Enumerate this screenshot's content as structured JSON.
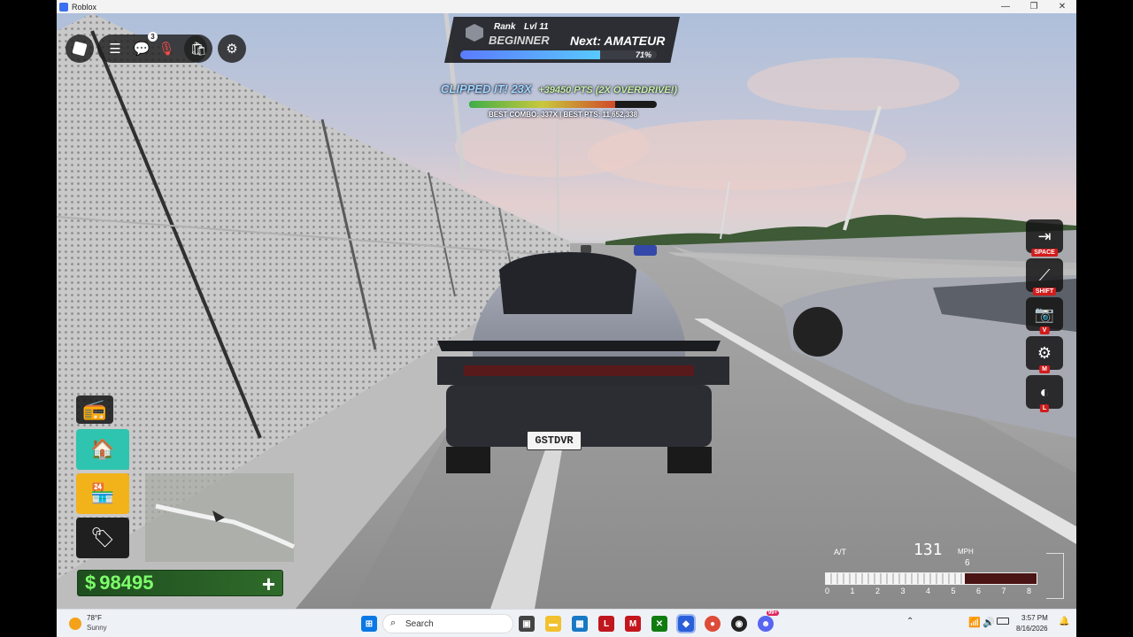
{
  "window": {
    "title": "Roblox",
    "controls": {
      "minimize": "—",
      "maximize": "❐",
      "close": "✕"
    }
  },
  "topbar": {
    "notification_count": "3",
    "icons": [
      "roblox-logo-icon",
      "menu-icon",
      "chat-icon",
      "mic-icon",
      "backpack-icon",
      "settings-icon"
    ]
  },
  "rank": {
    "label": "Rank",
    "level": "Lvl 11",
    "current": "BEGINNER",
    "next": "Next: AMATEUR",
    "progress_text": "71%",
    "progress": 0.71
  },
  "combo": {
    "title": "CLIPPED IT! 23X",
    "points": "+39450 PTS (2X OVERDRIVE!)",
    "best": "BEST COMBO: 337X | BEST PTS: 11,652,338",
    "meter": 0.78
  },
  "car": {
    "plate": "GSTDVR"
  },
  "side_menu": {
    "items": [
      {
        "name": "radio-button",
        "icon": "radio-icon"
      },
      {
        "name": "garage-button",
        "icon": "garage-icon"
      },
      {
        "name": "shop-button",
        "icon": "shop-icon"
      },
      {
        "name": "dealership-button",
        "icon": "car-tag-icon"
      }
    ]
  },
  "money": {
    "currency": "$",
    "amount": "98495",
    "add": "+"
  },
  "keybinds": [
    {
      "icon": "exit-vehicle-icon",
      "key": "SPACE"
    },
    {
      "icon": "handbrake-icon",
      "key": "SHIFT"
    },
    {
      "icon": "camera-icon",
      "key": "V"
    },
    {
      "icon": "gearbox-icon",
      "key": "M"
    },
    {
      "icon": "headlights-icon",
      "key": "L"
    }
  ],
  "speedometer": {
    "mode": "A/T",
    "speed": "131",
    "unit": "MPH",
    "gear": "6",
    "ticks": [
      "0",
      "1",
      "2",
      "3",
      "4",
      "5",
      "6",
      "7",
      "8"
    ],
    "rpm_fraction": 0.66
  },
  "taskbar": {
    "weather_temp": "78°F",
    "weather_text": "Sunny",
    "search_placeholder": "Search",
    "time": "3:57 PM",
    "date": "8/16/2026",
    "chrome_badge": "99+",
    "colors": {
      "accent": "#0067c0"
    }
  }
}
